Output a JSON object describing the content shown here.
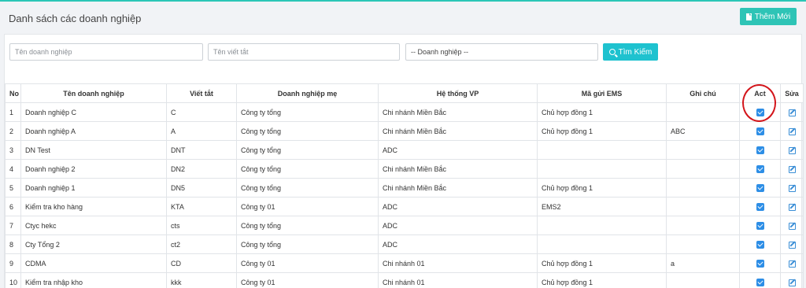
{
  "page": {
    "title": "Danh sách các doanh nghiệp",
    "add_button_label": "Thêm Mới"
  },
  "search": {
    "name_placeholder": "Tên doanh nghiệp",
    "abbr_placeholder": "Tên viết tắt",
    "company_select_value": "-- Doanh nghiệp --",
    "search_button_label": "Tìm Kiếm"
  },
  "table": {
    "headers": [
      "No",
      "Tên doanh nghiệp",
      "Viết tắt",
      "Doanh nghiệp mẹ",
      "Hệ thống VP",
      "Mã gửi EMS",
      "Ghi chú",
      "Act",
      "Sửa"
    ],
    "rows": [
      {
        "no": "1",
        "name": "Doanh nghiệp C",
        "abbr": "C",
        "parent": "Công ty tổng",
        "vp": "Chi nhánh Miền Bắc",
        "ems": "Chủ hợp đồng 1",
        "note": "",
        "act": true
      },
      {
        "no": "2",
        "name": "Doanh nghiệp A",
        "abbr": "A",
        "parent": "Công ty tổng",
        "vp": "Chi nhánh Miền Bắc",
        "ems": "Chủ hợp đồng 1",
        "note": "ABC",
        "act": true
      },
      {
        "no": "3",
        "name": "DN Test",
        "abbr": "DNT",
        "parent": "Công ty tổng",
        "vp": "ADC",
        "ems": "",
        "note": "",
        "act": true
      },
      {
        "no": "4",
        "name": "Doanh nghiệp 2",
        "abbr": "DN2",
        "parent": "Công ty tổng",
        "vp": "Chi nhánh Miền Bắc",
        "ems": "",
        "note": "",
        "act": true
      },
      {
        "no": "5",
        "name": "Doanh nghiệp 1",
        "abbr": "DN5",
        "parent": "Công ty tổng",
        "vp": "Chi nhánh Miền Bắc",
        "ems": "Chủ hợp đồng 1",
        "note": "",
        "act": true
      },
      {
        "no": "6",
        "name": "Kiểm tra kho hàng",
        "abbr": "KTA",
        "parent": "Công ty 01",
        "vp": "ADC",
        "ems": "EMS2",
        "note": "",
        "act": true
      },
      {
        "no": "7",
        "name": "Ctyc hekc",
        "abbr": "cts",
        "parent": "Công ty tổng",
        "vp": "ADC",
        "ems": "",
        "note": "",
        "act": true
      },
      {
        "no": "8",
        "name": "Cty Tổng 2",
        "abbr": "ct2",
        "parent": "Công ty tổng",
        "vp": "ADC",
        "ems": "",
        "note": "",
        "act": true
      },
      {
        "no": "9",
        "name": "CDMA",
        "abbr": "CD",
        "parent": "Công ty 01",
        "vp": "Chi nhánh 01",
        "ems": "Chủ hợp đồng 1",
        "note": "a",
        "act": true
      },
      {
        "no": "10",
        "name": "Kiểm tra nhập kho",
        "abbr": "kkk",
        "parent": "Công ty 01",
        "vp": "Chi nhánh 01",
        "ems": "Chủ hợp đồng 1",
        "note": "",
        "act": true
      }
    ]
  },
  "icons": {
    "add": "document-icon",
    "search": "search-icon",
    "act": "checkbox-icon",
    "edit": "edit-icon"
  },
  "colors": {
    "accent": "#2ec4b6",
    "search_button": "#1ec2cf",
    "checkbox": "#2d8ee6",
    "highlight": "#d3151b"
  }
}
